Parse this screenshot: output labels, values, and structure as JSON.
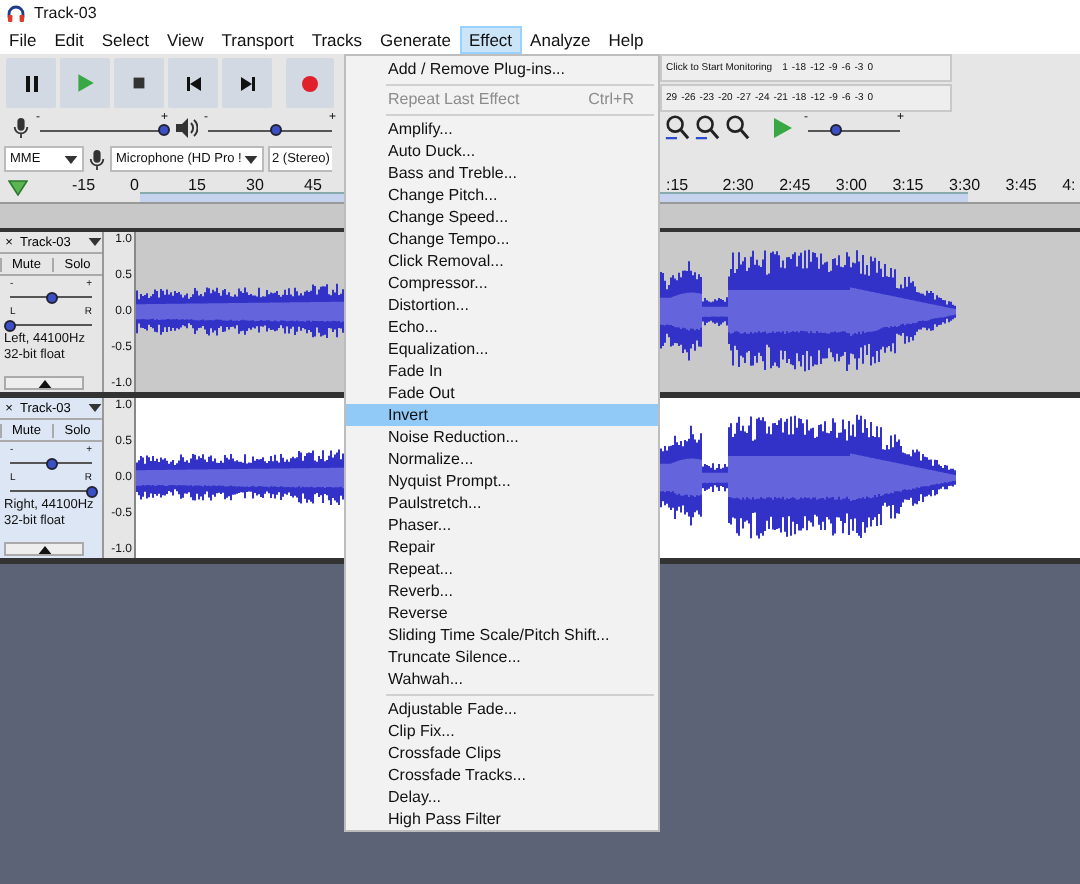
{
  "window": {
    "title": "Track-03"
  },
  "menubar": [
    {
      "label": "File",
      "selected": false
    },
    {
      "label": "Edit",
      "selected": false
    },
    {
      "label": "Select",
      "selected": false
    },
    {
      "label": "View",
      "selected": false
    },
    {
      "label": "Transport",
      "selected": false
    },
    {
      "label": "Tracks",
      "selected": false
    },
    {
      "label": "Generate",
      "selected": false
    },
    {
      "label": "Effect",
      "selected": true
    },
    {
      "label": "Analyze",
      "selected": false
    },
    {
      "label": "Help",
      "selected": false
    }
  ],
  "meters": {
    "record_label": "Click to Start Monitoring",
    "record_scale": [
      "1",
      "-18",
      "-12",
      "-9",
      "-6",
      "-3",
      "0"
    ],
    "playback_scale": [
      "29",
      "-26",
      "-23",
      "-20",
      "-27",
      "-24",
      "-21",
      "-18",
      "-12",
      "-9",
      "-6",
      "-3",
      "0"
    ]
  },
  "mixer": {
    "record_volume": {
      "min": "-",
      "max": "+",
      "level": 1.0
    },
    "playback_volume": {
      "min": "-",
      "max": "+",
      "level": 0.55
    }
  },
  "play_at_speed": {
    "min": "-",
    "max": "+",
    "level": 0.3
  },
  "device": {
    "host": "MME",
    "input": "Microphone (HD Pro !",
    "channels": "2 (Stereo)"
  },
  "ruler": {
    "left_labels": [
      "-15",
      "0",
      "15",
      "30",
      "45"
    ],
    "right_labels": [
      ":15",
      "2:30",
      "2:45",
      "3:00",
      "3:15",
      "3:30",
      "3:45",
      "4:"
    ]
  },
  "tracks": [
    {
      "close": "×",
      "name": "Track-03",
      "mute": "Mute",
      "solo": "Solo",
      "selected": false,
      "gain": {
        "min": "-",
        "max": "+",
        "level": 0.5
      },
      "pan": {
        "left": "L",
        "right": "R",
        "level": 0.0
      },
      "info": "Left, 44100Hz",
      "format": "32-bit float",
      "scale": [
        "1.0",
        "0.5",
        "0.0",
        "-0.5",
        "-1.0"
      ]
    },
    {
      "close": "×",
      "name": "Track-03",
      "mute": "Mute",
      "solo": "Solo",
      "selected": true,
      "gain": {
        "min": "-",
        "max": "+",
        "level": 0.5
      },
      "pan": {
        "left": "L",
        "right": "R",
        "level": 1.0
      },
      "info": "Right, 44100Hz",
      "format": "32-bit float",
      "scale": [
        "1.0",
        "0.5",
        "0.0",
        "-0.5",
        "-1.0"
      ]
    }
  ],
  "menu": {
    "groups": [
      [
        {
          "label": "Add / Remove Plug-ins...",
          "disabled": false,
          "selected": false
        }
      ],
      [
        {
          "label": "Repeat Last Effect",
          "shortcut": "Ctrl+R",
          "disabled": true,
          "selected": false
        }
      ],
      [
        {
          "label": "Amplify...",
          "disabled": false,
          "selected": false
        },
        {
          "label": "Auto Duck...",
          "disabled": false,
          "selected": false
        },
        {
          "label": "Bass and Treble...",
          "disabled": false,
          "selected": false
        },
        {
          "label": "Change Pitch...",
          "disabled": false,
          "selected": false
        },
        {
          "label": "Change Speed...",
          "disabled": false,
          "selected": false
        },
        {
          "label": "Change Tempo...",
          "disabled": false,
          "selected": false
        },
        {
          "label": "Click Removal...",
          "disabled": false,
          "selected": false
        },
        {
          "label": "Compressor...",
          "disabled": false,
          "selected": false
        },
        {
          "label": "Distortion...",
          "disabled": false,
          "selected": false
        },
        {
          "label": "Echo...",
          "disabled": false,
          "selected": false
        },
        {
          "label": "Equalization...",
          "disabled": false,
          "selected": false
        },
        {
          "label": "Fade In",
          "disabled": false,
          "selected": false
        },
        {
          "label": "Fade Out",
          "disabled": false,
          "selected": false
        },
        {
          "label": "Invert",
          "disabled": false,
          "selected": true
        },
        {
          "label": "Noise Reduction...",
          "disabled": false,
          "selected": false
        },
        {
          "label": "Normalize...",
          "disabled": false,
          "selected": false
        },
        {
          "label": "Nyquist Prompt...",
          "disabled": false,
          "selected": false
        },
        {
          "label": "Paulstretch...",
          "disabled": false,
          "selected": false
        },
        {
          "label": "Phaser...",
          "disabled": false,
          "selected": false
        },
        {
          "label": "Repair",
          "disabled": false,
          "selected": false
        },
        {
          "label": "Repeat...",
          "disabled": false,
          "selected": false
        },
        {
          "label": "Reverb...",
          "disabled": false,
          "selected": false
        },
        {
          "label": "Reverse",
          "disabled": false,
          "selected": false
        },
        {
          "label": "Sliding Time Scale/Pitch Shift...",
          "disabled": false,
          "selected": false
        },
        {
          "label": "Truncate Silence...",
          "disabled": false,
          "selected": false
        },
        {
          "label": "Wahwah...",
          "disabled": false,
          "selected": false
        }
      ],
      [
        {
          "label": "Adjustable Fade...",
          "disabled": false,
          "selected": false
        },
        {
          "label": "Clip Fix...",
          "disabled": false,
          "selected": false
        },
        {
          "label": "Crossfade Clips",
          "disabled": false,
          "selected": false
        },
        {
          "label": "Crossfade Tracks...",
          "disabled": false,
          "selected": false
        },
        {
          "label": "Delay...",
          "disabled": false,
          "selected": false
        },
        {
          "label": "High Pass Filter",
          "disabled": false,
          "selected": false
        }
      ]
    ]
  }
}
